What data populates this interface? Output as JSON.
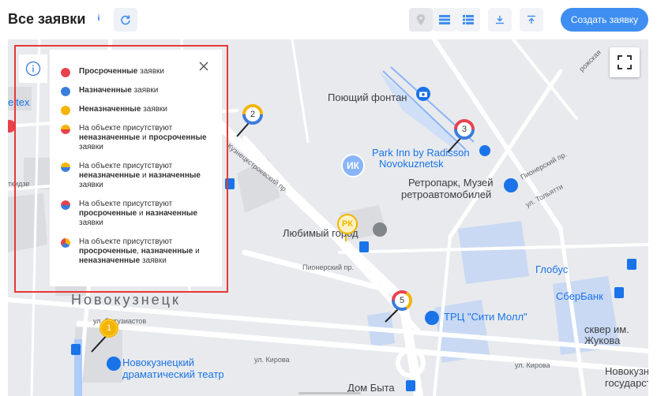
{
  "header": {
    "title": "Все заявки",
    "info_glyph": "i",
    "create_label": "Создать заявку"
  },
  "colors": {
    "accent": "#3f8ef1",
    "overdue": "#e8414d",
    "assigned": "#3b7ddd",
    "unassigned": "#f4b400",
    "legend_border": "#e53935"
  },
  "icons": [
    "info-icon",
    "refresh-icon",
    "pin-view-icon",
    "list-view-icon",
    "detail-list-icon",
    "download-icon",
    "upload-icon",
    "fullscreen-icon",
    "close-icon"
  ],
  "legend": {
    "items": [
      {
        "html": "<b>Просроченные</b> заявки"
      },
      {
        "html": "<b>Назначенные</b> заявки"
      },
      {
        "html": "<b>Неназначенные</b> заявки"
      },
      {
        "html": "На объекте присутствуют <b>неназначенные</b> и <b>просроченные</b> заявки"
      },
      {
        "html": "На объекте присутствуют <b>неназначенные</b> и <b>назначенные</b> заявки"
      },
      {
        "html": "На объекте присутствуют <b>просроченные</b> и <b>назначенные</b> заявки"
      },
      {
        "html": "На объекте присутствуют <b>просроченные</b>, <b>назначенные</b> и <b>неназначенные</b> заявки"
      }
    ]
  },
  "map": {
    "labels": {
      "fountain": "Поющий фонтан",
      "hotel_1": "Park Inn by Radisson",
      "hotel_2": "Novokuznetsk",
      "retro_1": "Ретропарк, Музей",
      "retro_2": "ретроавтомобилей",
      "love_city": "Любимый город",
      "pioneer_1": "Пионерский пр.",
      "pioneer_2": "Пионерский пр.",
      "kuz_pr": "Кузнецкстроевский пр.",
      "tolyatti": "ул. Тольятти",
      "globus": "Глобус",
      "sberbank": "СберБанк",
      "trc": "ТРЦ \"Сити Молл\"",
      "square_1": "сквер им.",
      "square_2": "Жукова",
      "novokuz_right_1": "Новокузнец",
      "novokuz_right_2": "государств",
      "city": "Новокузнецк",
      "entuz": "ул. Энтузиастов",
      "theatre_1": "Новокузнецкий",
      "theatre_2": "драматический театр",
      "kirova_1": "ул. Кирова",
      "kirova_2": "ул. Кирова",
      "dom_byta": "Дом Быта",
      "left_brand": "eltex",
      "left_street": "ткидзе",
      "right_top": "рожская",
      "ik": "ИК",
      "rk": "РК"
    },
    "markers": [
      {
        "num": "1",
        "type": "unassigned"
      },
      {
        "num": "2",
        "type": "unassigned-assigned"
      },
      {
        "num": "3",
        "type": "overdue-assigned"
      },
      {
        "num": "5",
        "type": "all"
      }
    ]
  }
}
